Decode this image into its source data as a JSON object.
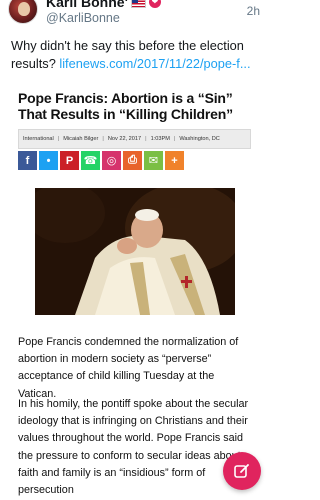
{
  "tweet": {
    "author_name": "Karli Bonne'",
    "handle": "@KarliBonne",
    "time": "2h",
    "text": "Why didn't he say this before the election results?",
    "link_text": "lifenews.com/2017/11/22/pope-f..."
  },
  "article": {
    "title": "Pope Francis: Abortion is a “Sin” That Results in “Killing Children”",
    "meta": {
      "section": "International",
      "author": "Micaiah Bilger",
      "date": "Nov 22, 2017",
      "time": "1:03PM",
      "location": "Washington, DC"
    },
    "share_buttons": [
      {
        "name": "facebook-icon",
        "glyph": "f",
        "color": "#3b5998"
      },
      {
        "name": "twitter-icon",
        "glyph": "•",
        "color": "#1da1f2"
      },
      {
        "name": "pinterest-icon",
        "glyph": "P",
        "color": "#cb2027"
      },
      {
        "name": "whatsapp-icon",
        "glyph": "☎",
        "color": "#25d366"
      },
      {
        "name": "instagram-icon",
        "glyph": "◎",
        "color": "#d6336c"
      },
      {
        "name": "print-icon",
        "glyph": "⎙",
        "color": "#e8632c"
      },
      {
        "name": "email-icon",
        "glyph": "✉",
        "color": "#7bbf44"
      },
      {
        "name": "more-share-icon",
        "glyph": "+",
        "color": "#f0822b"
      }
    ],
    "paragraph_1": "Pope Francis condemned the normalization of abortion in modern society as “perverse” acceptance of child killing Tuesday at the Vatican.",
    "paragraph_2": "In his homily, the pontiff spoke about the secular ideology that is infringing on Christians and their values throughout the world. Pope Francis said the pressure to conform to secular ideas about faith and family is an “insidious” form of persecution"
  },
  "compose_button": {
    "icon": "compose-icon",
    "color": "#e0245e"
  }
}
